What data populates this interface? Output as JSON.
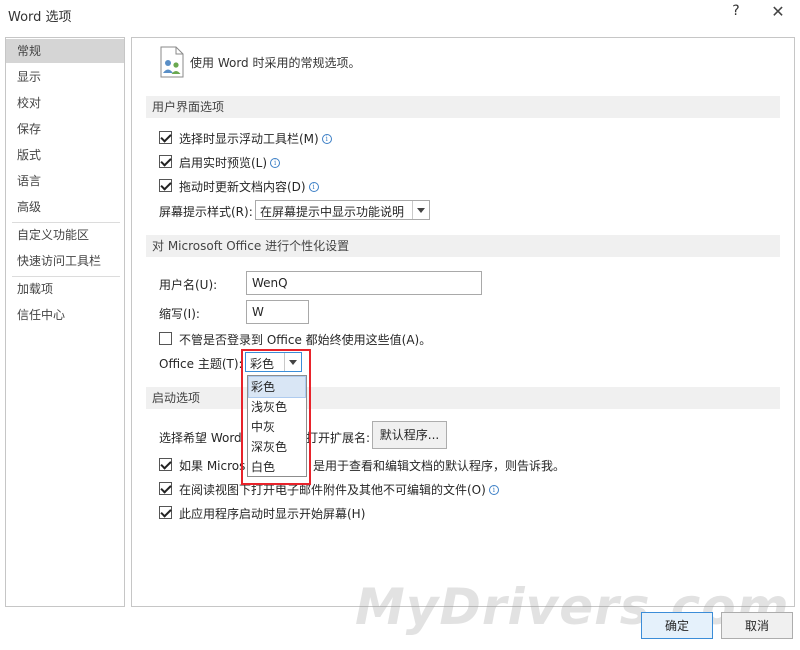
{
  "window": {
    "title": "Word 选项",
    "help_glyph": "?",
    "close_glyph": "✕"
  },
  "sidebar": {
    "items": [
      {
        "label": "常规",
        "selected": true
      },
      {
        "label": "显示"
      },
      {
        "label": "校对"
      },
      {
        "label": "保存"
      },
      {
        "label": "版式"
      },
      {
        "label": "语言"
      },
      {
        "label": "高级"
      },
      {
        "label": "自定义功能区"
      },
      {
        "label": "快速访问工具栏"
      },
      {
        "label": "加载项"
      },
      {
        "label": "信任中心"
      }
    ]
  },
  "header": {
    "text": "使用 Word 时采用的常规选项。",
    "icon": "settings-people-icon"
  },
  "ui_options": {
    "title": "用户界面选项",
    "mini_toolbar": {
      "label": "选择时显示浮动工具栏(M)",
      "checked": true
    },
    "live_preview": {
      "label": "启用实时预览(L)",
      "checked": true
    },
    "update_drag": {
      "label": "拖动时更新文档内容(D)",
      "checked": true
    },
    "screentip_label": "屏幕提示样式(R):",
    "screentip_value": "在屏幕提示中显示功能说明"
  },
  "personalize": {
    "title": "对 Microsoft Office 进行个性化设置",
    "username_label": "用户名(U):",
    "username_value": "WenQ",
    "initials_label": "缩写(I):",
    "initials_value": "W",
    "always_use": {
      "label": "不管是否登录到 Office 都始终使用这些值(A)。",
      "checked": false
    },
    "theme_label": "Office 主题(T):",
    "theme_value": "彩色",
    "theme_options": [
      "彩色",
      "浅灰色",
      "中灰",
      "深灰色",
      "白色"
    ]
  },
  "startup": {
    "title": "启动选项",
    "default_prog_label_left": "选择希望 Word",
    "default_prog_label_right": "打开扩展名:",
    "default_prog_button": "默认程序...",
    "tell_me": {
      "label_left": "如果 Micros",
      "label_right": "是用于查看和编辑文档的默认程序，则告诉我。",
      "checked": true
    },
    "open_attachments": {
      "label": "在阅读视图下打开电子邮件附件及其他不可编辑的文件(O)",
      "checked": true
    },
    "show_start": {
      "label": "此应用程序启动时显示开始屏幕(H)",
      "checked": true
    }
  },
  "footer": {
    "ok": "确定",
    "cancel": "取消"
  },
  "watermark": "MyDrivers.com",
  "colors": {
    "highlight": "#e8232b",
    "selected_nav": "#d5d5d5",
    "section_bg": "#f0f0f0",
    "info_blue": "#3c7fc6"
  }
}
